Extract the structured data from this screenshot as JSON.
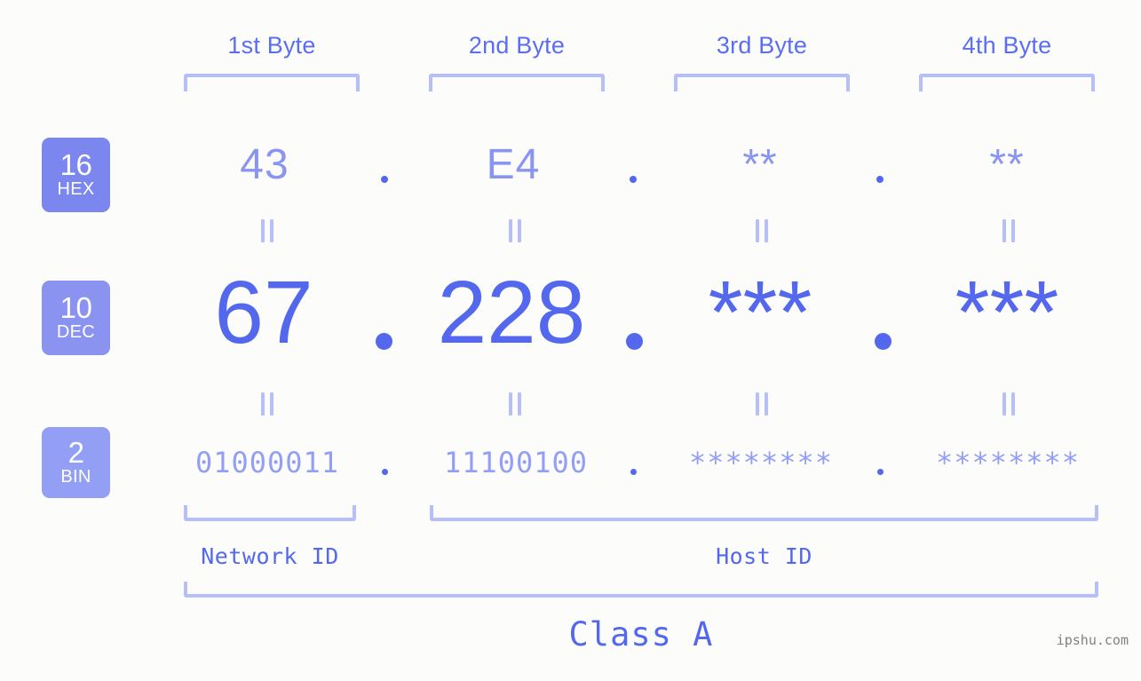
{
  "meta": {
    "background_color": "#fcfdfa",
    "accent_color": "#5468ee",
    "accent_light_color": "#8a95f2",
    "bracket_color": "#b6bffa",
    "watermark": "ipshu.com"
  },
  "columns": [
    {
      "label": "1st Byte"
    },
    {
      "label": "2nd Byte"
    },
    {
      "label": "3rd Byte"
    },
    {
      "label": "4th Byte"
    }
  ],
  "rows": {
    "hex": {
      "badge_number": "16",
      "badge_name": "HEX",
      "badge_color": "#7b86ee",
      "values": [
        "43",
        "E4",
        "**",
        "**"
      ],
      "separator": "."
    },
    "dec": {
      "badge_number": "10",
      "badge_name": "DEC",
      "badge_color": "#8a93f0",
      "values": [
        "67",
        "228",
        "***",
        "***"
      ],
      "separator": "."
    },
    "bin": {
      "badge_number": "2",
      "badge_name": "BIN",
      "badge_color": "#939ef5",
      "values": [
        "01000011",
        "11100100",
        "********",
        "********"
      ],
      "separator": "."
    }
  },
  "segments": {
    "network_id": "Network ID",
    "host_id": "Host ID",
    "class": "Class A"
  }
}
